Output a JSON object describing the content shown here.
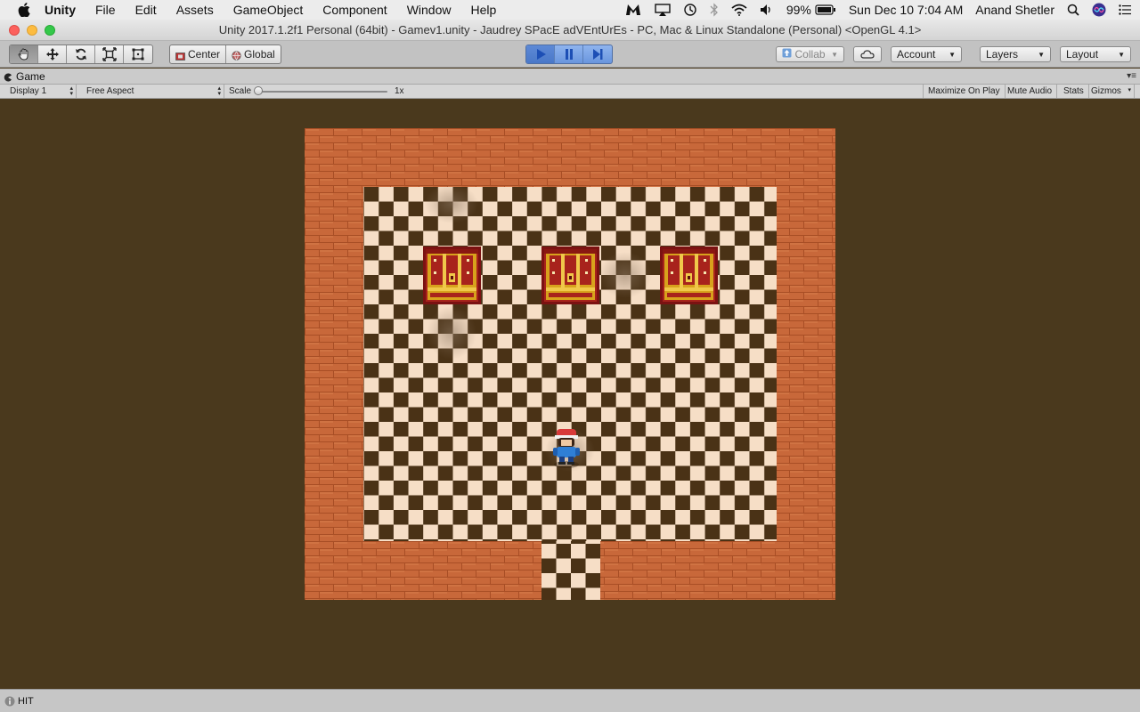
{
  "menubar": {
    "app_name": "Unity",
    "menus": [
      "File",
      "Edit",
      "Assets",
      "GameObject",
      "Component",
      "Window",
      "Help"
    ],
    "battery": "99%",
    "datetime": "Sun Dec 10  7:04 AM",
    "user": "Anand Shetler"
  },
  "window": {
    "title": "Unity 2017.1.2f1 Personal (64bit) - Gamev1.unity - Jaudrey SPacE adVEntUrEs - PC, Mac & Linux Standalone (Personal) <OpenGL 4.1>"
  },
  "toolbar": {
    "pivot_center": "Center",
    "pivot_global": "Global",
    "collab": "Collab",
    "account": "Account",
    "layers": "Layers",
    "layout": "Layout"
  },
  "game_view": {
    "tab_label": "Game",
    "display": "Display 1",
    "aspect": "Free Aspect",
    "scale_label": "Scale",
    "scale_value": "1x",
    "maximize_on_play": "Maximize On Play",
    "mute_audio": "Mute Audio",
    "stats": "Stats",
    "gizmos": "Gizmos"
  },
  "game": {
    "chests": 3,
    "player": "trainer-character"
  },
  "status": {
    "message": "HIT"
  },
  "colors": {
    "brick": "#c8683a",
    "tile_dark": "#4a3216",
    "tile_light": "#f6dec6",
    "viewport_bg": "#4a391d",
    "play_accent": "#6a96de"
  }
}
